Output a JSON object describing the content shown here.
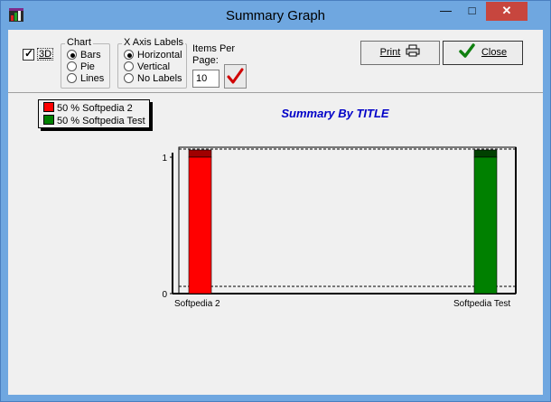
{
  "window": {
    "title": "Summary Graph"
  },
  "toolbar": {
    "three_d": {
      "label": "3D",
      "checked": true
    },
    "chart_group": {
      "title": "Chart",
      "options": [
        "Bars",
        "Pie",
        "Lines"
      ],
      "selected": "Bars"
    },
    "xaxis_group": {
      "title": "X Axis Labels",
      "options": [
        "Horizontal",
        "Vertical",
        "No Labels"
      ],
      "selected": "Horizontal"
    },
    "items_per_page": {
      "label_line1": "Items Per",
      "label_line2": "Page:",
      "value": "10"
    },
    "print_label": "Print",
    "close_label": "Close"
  },
  "legend": [
    {
      "label": "50 % Softpedia 2",
      "color": "#ff0000"
    },
    {
      "label": "50 % Softpedia Test",
      "color": "#008000"
    }
  ],
  "chart_data": {
    "type": "bar",
    "title": "Summary By TITLE",
    "categories": [
      "Softpedia 2",
      "Softpedia Test"
    ],
    "values": [
      1,
      1
    ],
    "colors": [
      "#ff0000",
      "#008000"
    ],
    "ylim": [
      0,
      1
    ],
    "yticks": [
      "0",
      "1"
    ],
    "three_d": true
  }
}
